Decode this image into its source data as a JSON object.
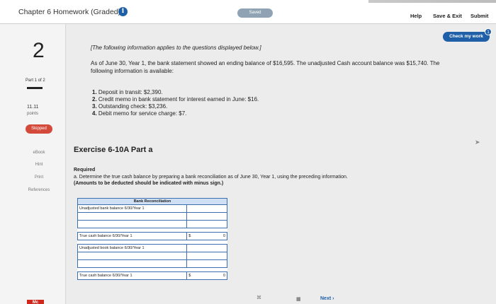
{
  "header": {
    "title": "Chapter 6 Homework (Graded)",
    "saved": "Saved",
    "help": "Help",
    "save_exit": "Save & Exit",
    "submit": "Submit",
    "check_my_work": "Check my work",
    "check_badge": "1"
  },
  "sidebar": {
    "question_number": "2",
    "part": "Part 1 of 2",
    "points_value": "11.11",
    "points_label": "points",
    "status": "Skipped",
    "links": [
      "eBook",
      "Hint",
      "Print",
      "References"
    ]
  },
  "question": {
    "note": "[The following information applies to the questions displayed below.]",
    "intro": "As of June 30, Year 1, the bank statement showed an ending balance of $16,595. The unadjusted Cash account balance was $15,740. The following information is available:",
    "items": [
      {
        "num": "1.",
        "text": "Deposit in transit: $2,390."
      },
      {
        "num": "2.",
        "text": "Credit memo in bank statement for interest earned in June: $16."
      },
      {
        "num": "3.",
        "text": "Outstanding check: $3,236."
      },
      {
        "num": "4.",
        "text": "Debit memo for service charge: $7."
      }
    ],
    "exercise_title": "Exercise 6-10A Part a",
    "required_label": "Required",
    "required_text": "a. Determine the true cash balance by preparing a bank reconciliation as of June 30, Year 1, using the preceding information.",
    "required_note": "(Amounts to be deducted should be indicated with minus sign.)"
  },
  "reconciliation": {
    "title": "Bank Reconciliation",
    "unadjusted_bank": "Unadjusted bank balance 6/30/Year 1",
    "true_cash_bank": "True cash balance 6/30/Year 1",
    "true_cash_bank_currency": "$",
    "true_cash_bank_value": "0",
    "unadjusted_book": "Unadjusted book balance 6/30/Year 1",
    "true_cash_book": "True cash balance 6/30/Year 1",
    "true_cash_book_currency": "$",
    "true_cash_book_value": "0"
  },
  "footer": {
    "next": "Next ›"
  },
  "colors": {
    "brand_blue": "#1f5fa8",
    "skipped_red": "#d44a3a",
    "table_border": "#3c6fb0"
  }
}
